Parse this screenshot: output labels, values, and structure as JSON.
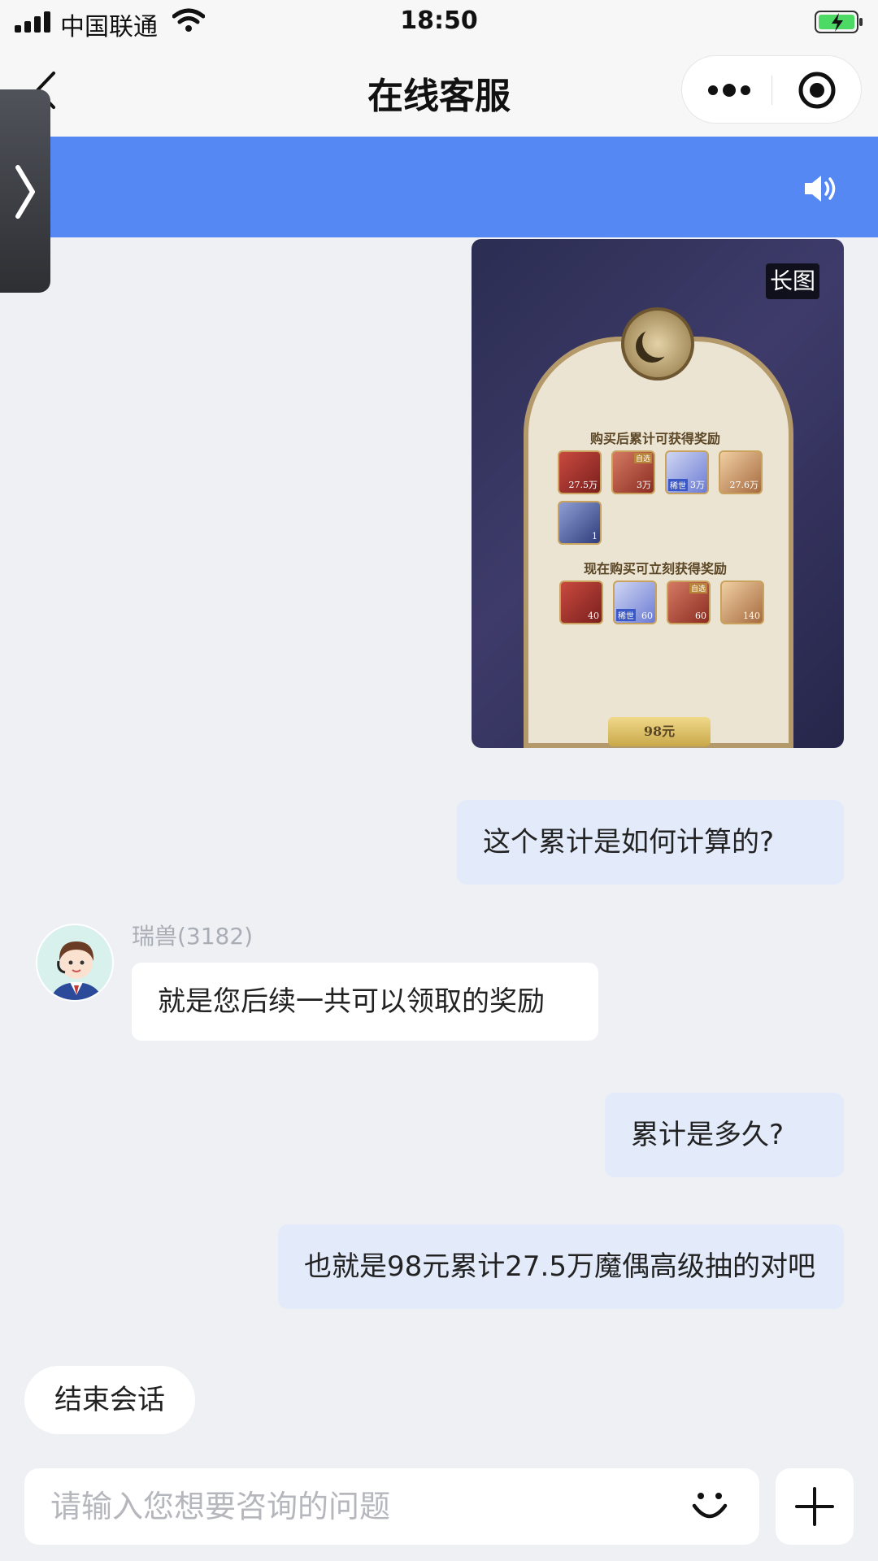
{
  "status_bar": {
    "carrier": "中国联通",
    "time": "18:50",
    "icons": [
      "signal-icon",
      "wifi-icon",
      "battery-charging-icon"
    ]
  },
  "nav": {
    "title": "在线客服",
    "icons": [
      "back-icon",
      "more-icon",
      "target-icon"
    ]
  },
  "banner": {
    "color": "#5688f4",
    "icon": "speaker-icon"
  },
  "messages": {
    "image_message": {
      "badge": "长图",
      "section_1": "购买后累计可获得奖励",
      "section_2": "现在购买可立刻获得奖励",
      "price": "98元",
      "tag_pick": "自选",
      "tag_rare": "稀世",
      "row1": [
        "27.5万",
        "3万",
        "3万",
        "27.6万"
      ],
      "row2": [
        "1"
      ],
      "row3": [
        "40",
        "60",
        "60",
        "140"
      ]
    },
    "user_q1": "这个累计是如何计算的?",
    "agent_name": "瑞兽(3182)",
    "agent_reply": "就是您后续一共可以领取的奖励",
    "user_q2": "累计是多久?",
    "user_q3": "也就是98元累计27.5万魔偶高级抽的对吧"
  },
  "end_session_label": "结束会话",
  "input": {
    "placeholder": "请输入您想要咨询的问题",
    "value": ""
  },
  "colors": {
    "accent": "#5688f4",
    "self_bubble": "#e3ebfb",
    "background": "#eef0f4"
  }
}
